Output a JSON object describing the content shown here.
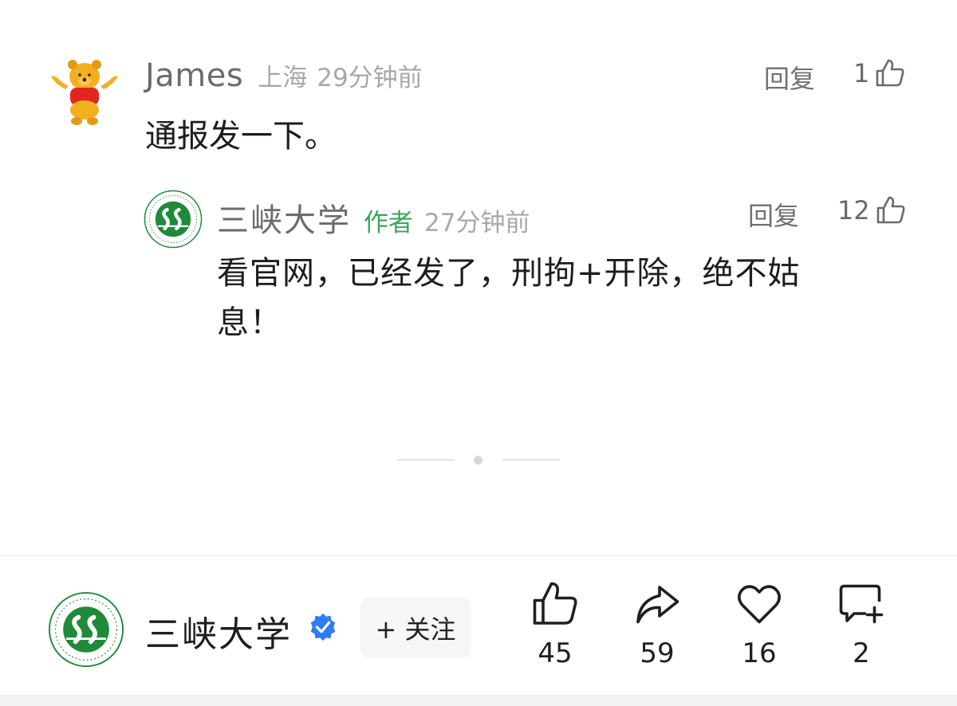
{
  "comment": {
    "user": "James",
    "location": "上海",
    "time": "29分钟前",
    "body": "通报发一下。",
    "reply_label": "回复",
    "likes": "1",
    "avatar": "winnie-the-pooh-avatar"
  },
  "reply": {
    "user": "三峡大学",
    "badge": "作者",
    "time": "27分钟前",
    "body": "看官网，已经发了，刑拘+开除，绝不姑息！",
    "reply_label": "回复",
    "likes": "12",
    "avatar": "university-logo-avatar"
  },
  "footer": {
    "account_name": "三峡大学",
    "verified_icon": "verified-badge-icon",
    "follow_label": "+ 关注",
    "actions": {
      "like_count": "45",
      "share_count": "59",
      "favorite_count": "16",
      "comment_count": "2"
    }
  },
  "colors": {
    "author_badge": "#3aa757",
    "verified": "#2f7bf6",
    "logo_green": "#1f8a3a"
  }
}
